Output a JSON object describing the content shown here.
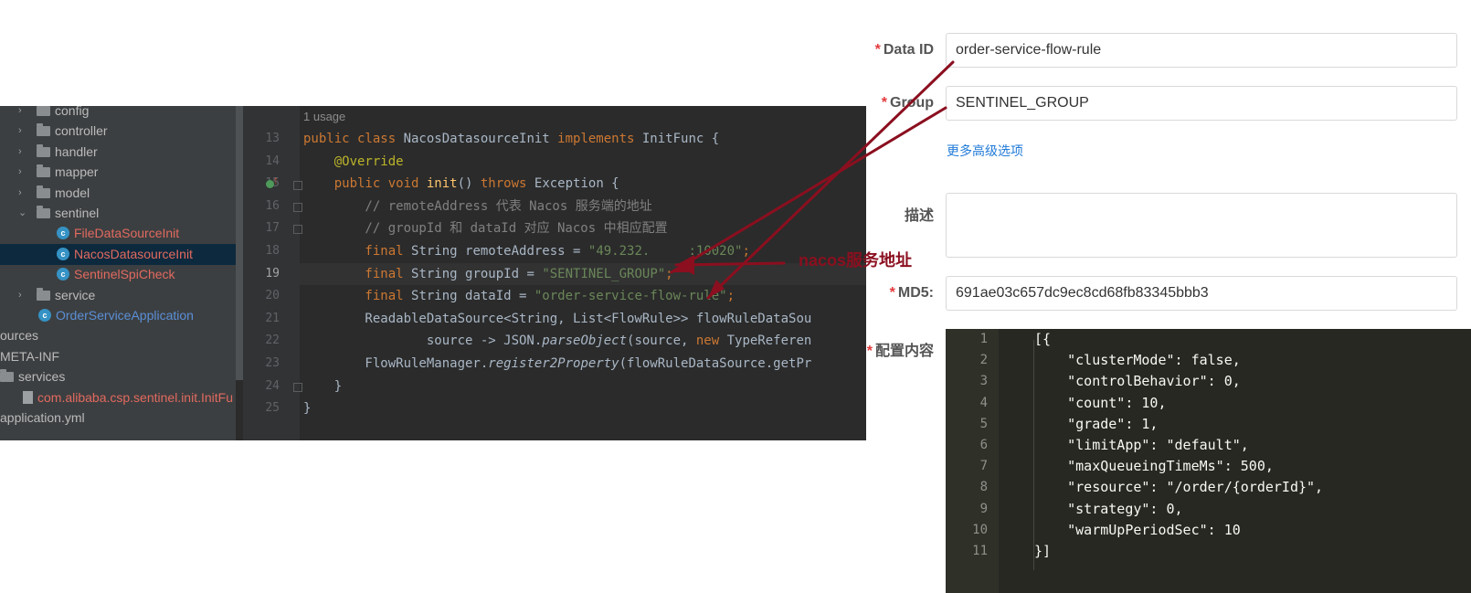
{
  "ide": {
    "tree": [
      {
        "label": "config",
        "kind": "folder",
        "indent": 1,
        "arrow": "›"
      },
      {
        "label": "controller",
        "kind": "folder",
        "indent": 1,
        "arrow": "›"
      },
      {
        "label": "handler",
        "kind": "folder",
        "indent": 1,
        "arrow": "›"
      },
      {
        "label": "mapper",
        "kind": "folder",
        "indent": 1,
        "arrow": "›"
      },
      {
        "label": "model",
        "kind": "folder",
        "indent": 1,
        "arrow": "›"
      },
      {
        "label": "sentinel",
        "kind": "folder",
        "indent": 1,
        "arrow": "⌄"
      },
      {
        "label": "FileDataSourceInit",
        "kind": "class",
        "indent": 2,
        "color": "red"
      },
      {
        "label": "NacosDatasourceInit",
        "kind": "class",
        "indent": 2,
        "color": "red",
        "selected": true
      },
      {
        "label": "SentinelSpiCheck",
        "kind": "class",
        "indent": 2,
        "color": "red"
      },
      {
        "label": "service",
        "kind": "folder",
        "indent": 1,
        "arrow": "›"
      },
      {
        "label": "OrderServiceApplication",
        "kind": "class",
        "indent": 1,
        "color": "blue"
      },
      {
        "label": "ources",
        "kind": "text",
        "indent": 0
      },
      {
        "label": "META-INF",
        "kind": "text",
        "indent": 0
      },
      {
        "label": "services",
        "kind": "folder",
        "indent": 0
      },
      {
        "label": "com.alibaba.csp.sentinel.init.InitFu",
        "kind": "file",
        "indent": 1,
        "color": "red"
      },
      {
        "label": "application.yml",
        "kind": "text",
        "indent": 0
      }
    ],
    "usage": "1 usage",
    "line_numbers": [
      "13",
      "14",
      "15",
      "16",
      "17",
      "18",
      "19",
      "20",
      "21",
      "22",
      "23",
      "24",
      "25"
    ],
    "current_line": "19",
    "code": [
      [
        [
          "kw",
          "public class "
        ],
        [
          "",
          "NacosDatasourceInit "
        ],
        [
          "kw",
          "implements "
        ],
        [
          "",
          "InitFunc {"
        ]
      ],
      [
        [
          "ann",
          "    @Override"
        ]
      ],
      [
        [
          "kw",
          "    public void "
        ],
        [
          "fn",
          "init"
        ],
        [
          "",
          "() "
        ],
        [
          "kw",
          "throws "
        ],
        [
          "",
          "Exception {"
        ]
      ],
      [
        [
          "cmt",
          "        // remoteAddress 代表 Nacos 服务端的地址"
        ]
      ],
      [
        [
          "cmt",
          "        // groupId 和 dataId 对应 Nacos 中相应配置"
        ]
      ],
      [
        [
          "kw",
          "        final "
        ],
        [
          "",
          "String remoteAddress = "
        ],
        [
          "str",
          "\"49.232.     :10020\""
        ],
        [
          "kw",
          ";"
        ]
      ],
      [
        [
          "kw",
          "        final "
        ],
        [
          "",
          "String groupId = "
        ],
        [
          "str",
          "\"SENTINEL_GROUP\""
        ],
        [
          "kw",
          ";"
        ]
      ],
      [
        [
          "kw",
          "        final "
        ],
        [
          "",
          "String dataId = "
        ],
        [
          "str",
          "\"order-service-flow-rule\""
        ],
        [
          "kw",
          ";"
        ]
      ],
      [
        [
          "",
          "        ReadableDataSource<String, List<FlowRule>> flowRuleDataSou"
        ]
      ],
      [
        [
          "",
          "                source -> JSON."
        ],
        [
          "it",
          "parseObject"
        ],
        [
          "",
          "(source, "
        ],
        [
          "kw",
          "new "
        ],
        [
          "",
          "TypeReferen"
        ]
      ],
      [
        [
          "",
          "        FlowRuleManager."
        ],
        [
          "it",
          "register2Property"
        ],
        [
          "",
          "(flowRuleDataSource.getPr"
        ]
      ],
      [
        [
          "",
          "    }"
        ]
      ],
      [
        [
          "",
          "}"
        ]
      ]
    ]
  },
  "annotation": "nacos服务地址",
  "form": {
    "data_id_label": "Data ID",
    "data_id_value": "order-service-flow-rule",
    "group_label": "Group",
    "group_value": "SENTINEL_GROUP",
    "advanced_link": "更多高级选项",
    "desc_label": "描述",
    "md5_label": "MD5:",
    "md5_value": "691ae03c657dc9ec8cd68fb83345bbb3",
    "content_label": "配置内容",
    "required_mark": "*"
  },
  "editor": {
    "line_numbers": [
      "1",
      "2",
      "3",
      "4",
      "5",
      "6",
      "7",
      "8",
      "9",
      "10",
      "11"
    ],
    "lines": [
      "[{",
      "    \"clusterMode\": false,",
      "    \"controlBehavior\": 0,",
      "    \"count\": 10,",
      "    \"grade\": 1,",
      "    \"limitApp\": \"default\",",
      "    \"maxQueueingTimeMs\": 500,",
      "    \"resource\": \"/order/{orderId}\",",
      "    \"strategy\": 0,",
      "    \"warmUpPeriodSec\": 10",
      "}]"
    ]
  },
  "colors": {
    "arrow": "#8b0f1f",
    "ide_bg": "#2b2b2b",
    "editor_bg": "#272822"
  }
}
